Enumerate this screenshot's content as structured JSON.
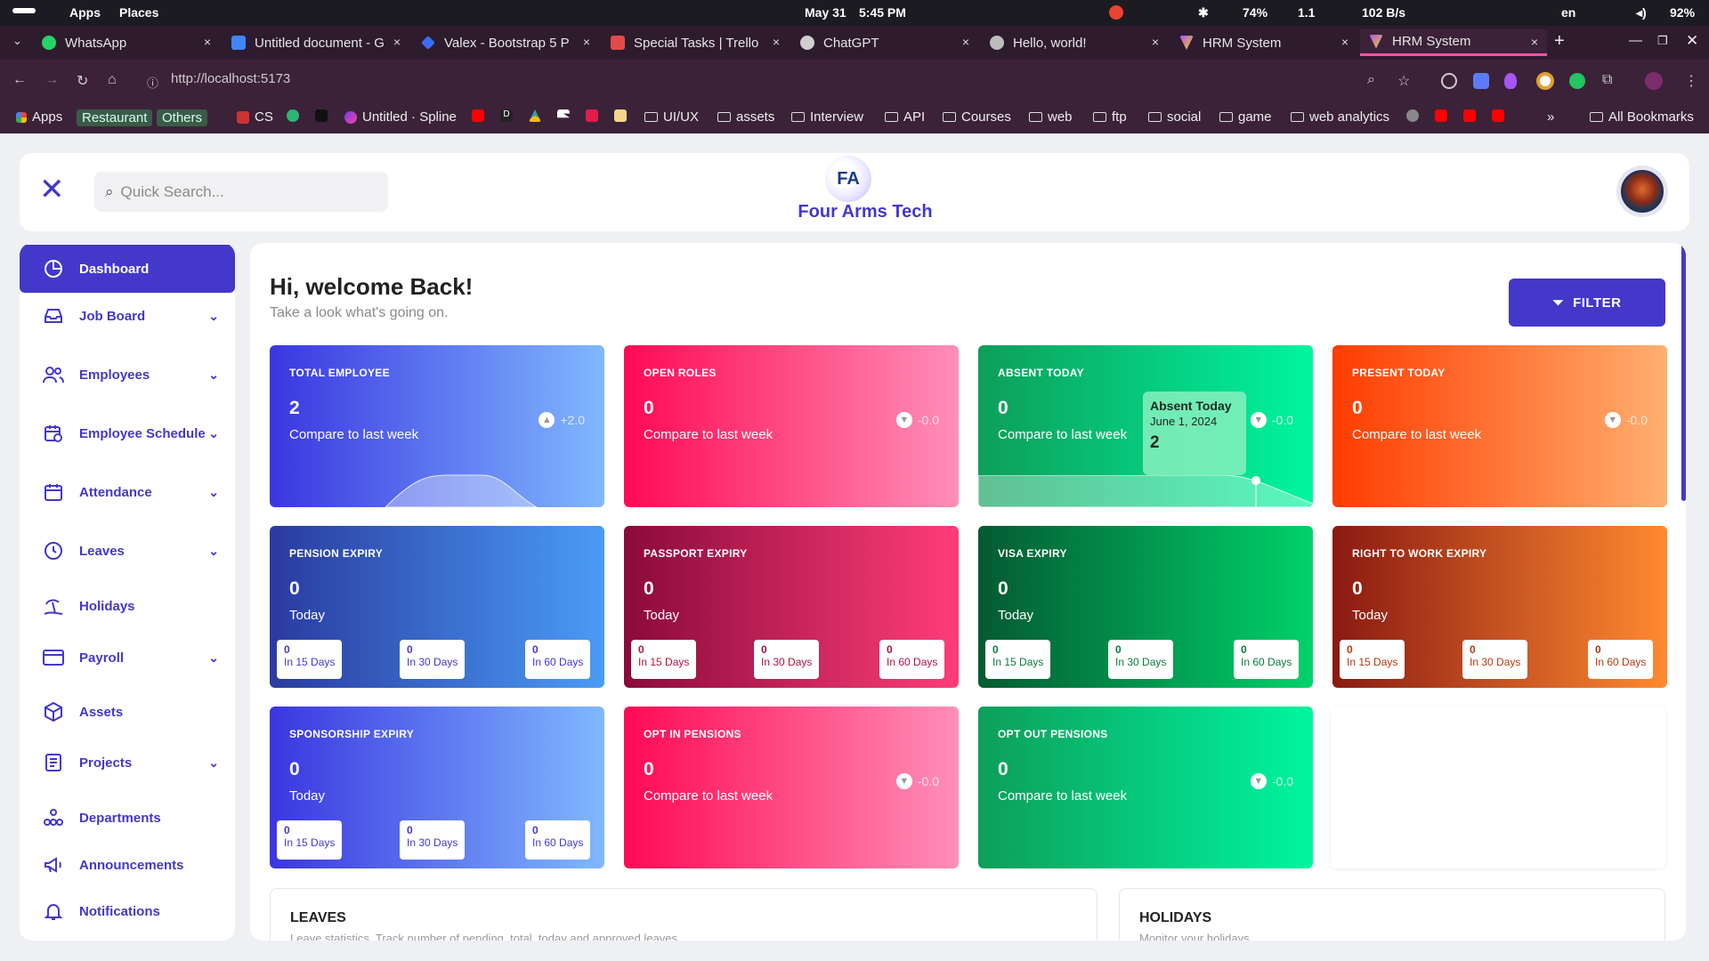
{
  "system": {
    "apps": "Apps",
    "places": "Places",
    "date": "May 31",
    "time": "5:45 PM",
    "battery_a": "74%",
    "net_a": "1.1",
    "speed": "102 B/s",
    "lang": "en",
    "battery": "92%"
  },
  "tabs": [
    {
      "label": "WhatsApp",
      "color": "#25d366"
    },
    {
      "label": "Untitled document - G",
      "color": "#4285f4"
    },
    {
      "label": "Valex - Bootstrap 5 P",
      "color": "#3b6cf6"
    },
    {
      "label": "Special Tasks | Trello",
      "color": "#e34b4b"
    },
    {
      "label": "ChatGPT",
      "color": "#cfcfcf"
    },
    {
      "label": "Hello, world!",
      "color": "#bdbdbd"
    },
    {
      "label": "HRM System",
      "color": "#a855f7"
    },
    {
      "label": "HRM System",
      "color": "#a855f7"
    }
  ],
  "tab_close": "×",
  "new_tab": "+",
  "address": {
    "url": "http://localhost:5173"
  },
  "bookmarks": {
    "apps": "Apps",
    "restaurant": "Restaurant",
    "others": "Others",
    "cs": "CS",
    "spline": "Untitled · Spline",
    "d": "D",
    "folders": [
      "UI/UX",
      "assets",
      "Interview",
      "API",
      "Courses",
      "web",
      "ftp",
      "social",
      "game",
      "web analytics"
    ],
    "all": "All Bookmarks",
    "more": "»"
  },
  "header": {
    "search_placeholder": "Quick Search...",
    "brand": "Four Arms Tech",
    "logo_text": "FA"
  },
  "sidebar": {
    "items": [
      {
        "label": "Dashboard",
        "icon": "dashboard-icon"
      },
      {
        "label": "Job Board",
        "icon": "inbox-icon"
      },
      {
        "label": "Employees",
        "icon": "users-icon"
      },
      {
        "label": "Employee Schedule",
        "icon": "calendar-clock-icon"
      },
      {
        "label": "Attendance",
        "icon": "calendar-icon"
      },
      {
        "label": "Leaves",
        "icon": "clock-icon"
      },
      {
        "label": "Holidays",
        "icon": "beach-icon"
      },
      {
        "label": "Payroll",
        "icon": "card-icon"
      },
      {
        "label": "Assets",
        "icon": "box-icon"
      },
      {
        "label": "Projects",
        "icon": "document-icon"
      },
      {
        "label": "Departments",
        "icon": "departments-icon"
      },
      {
        "label": "Announcements",
        "icon": "megaphone-icon"
      },
      {
        "label": "Notifications",
        "icon": "bell-icon"
      }
    ]
  },
  "main": {
    "greeting": "Hi, welcome Back!",
    "subtitle": "Take a look what's going on.",
    "filter": "FILTER",
    "cards": [
      {
        "title": "TOTAL EMPLOYEE",
        "value": "2",
        "sub": "Compare to last week",
        "trend": "+2.0"
      },
      {
        "title": "OPEN ROLES",
        "value": "0",
        "sub": "Compare to last week",
        "trend": "-0.0"
      },
      {
        "title": "ABSENT TODAY",
        "value": "0",
        "sub": "Compare to last week",
        "trend": "-0.0"
      },
      {
        "title": "PRESENT TODAY",
        "value": "0",
        "sub": "Compare to last week",
        "trend": "-0.0"
      },
      {
        "title": "PENSION EXPIRY",
        "value": "0",
        "sub": "Today",
        "m": [
          "0",
          "0",
          "0"
        ]
      },
      {
        "title": "PASSPORT EXPIRY",
        "value": "0",
        "sub": "Today",
        "m": [
          "0",
          "0",
          "0"
        ]
      },
      {
        "title": "VISA EXPIRY",
        "value": "0",
        "sub": "Today",
        "m": [
          "0",
          "0",
          "0"
        ]
      },
      {
        "title": "RIGHT TO WORK EXPIRY",
        "value": "0",
        "sub": "Today",
        "m": [
          "0",
          "0",
          "0"
        ]
      },
      {
        "title": "SPONSORSHIP EXPIRY",
        "value": "0",
        "sub": "Today",
        "m": [
          "0",
          "0",
          "0"
        ]
      },
      {
        "title": "OPT IN PENSIONS",
        "value": "0",
        "sub": "Compare to last week",
        "trend": "-0.0"
      },
      {
        "title": "OPT OUT PENSIONS",
        "value": "0",
        "sub": "Compare to last week",
        "trend": "-0.0"
      }
    ],
    "mini_labels": [
      "In 15 Days",
      "In 30 Days",
      "In 60 Days"
    ],
    "tooltip": {
      "title": "Absent Today",
      "date": "June 1, 2024",
      "value": "2"
    },
    "leaves": {
      "title": "LEAVES",
      "sub": "Leave statistics. Track number of pending, total, today and approved leaves."
    },
    "holidays": {
      "title": "HOLIDAYS",
      "sub": "Monitor your holidays"
    }
  },
  "colors": {
    "accent": "#4338ca"
  }
}
